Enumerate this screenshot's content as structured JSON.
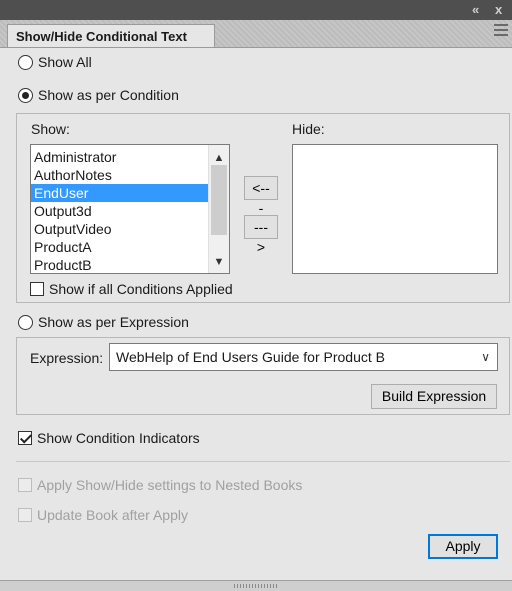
{
  "window": {
    "collapse_glyph": "«",
    "close_glyph": "x"
  },
  "panel": {
    "tab_label": "Show/Hide Conditional Text",
    "menu_icon": "hamburger-menu-icon"
  },
  "options": {
    "show_all": "Show All",
    "show_as_per_condition": "Show as per Condition",
    "show_as_per_expression": "Show as per Expression",
    "selected_mode": "show_as_per_condition"
  },
  "condition": {
    "show_label": "Show:",
    "hide_label": "Hide:",
    "show_items": [
      "Administrator",
      "AuthorNotes",
      "EndUser",
      "Output3d",
      "OutputVideo",
      "ProductA",
      "ProductB"
    ],
    "selected_item": "EndUser",
    "hide_items": [],
    "move_left_button": "<---",
    "move_right_button": "--->",
    "all_conditions_label": "Show if all Conditions Applied",
    "all_conditions_checked": false
  },
  "expression": {
    "label": "Expression:",
    "value": "WebHelp of End Users Guide for Product B",
    "build_button": "Build Expression"
  },
  "indicators": {
    "label": "Show Condition Indicators",
    "checked": true
  },
  "books": {
    "nested_label": "Apply Show/Hide settings to Nested Books",
    "update_label": "Update Book after Apply",
    "enabled": false
  },
  "apply_button": "Apply",
  "colors": {
    "selection": "#3399ff",
    "default_button_border": "#0078d7",
    "panel_bg": "#e6e6e6"
  }
}
